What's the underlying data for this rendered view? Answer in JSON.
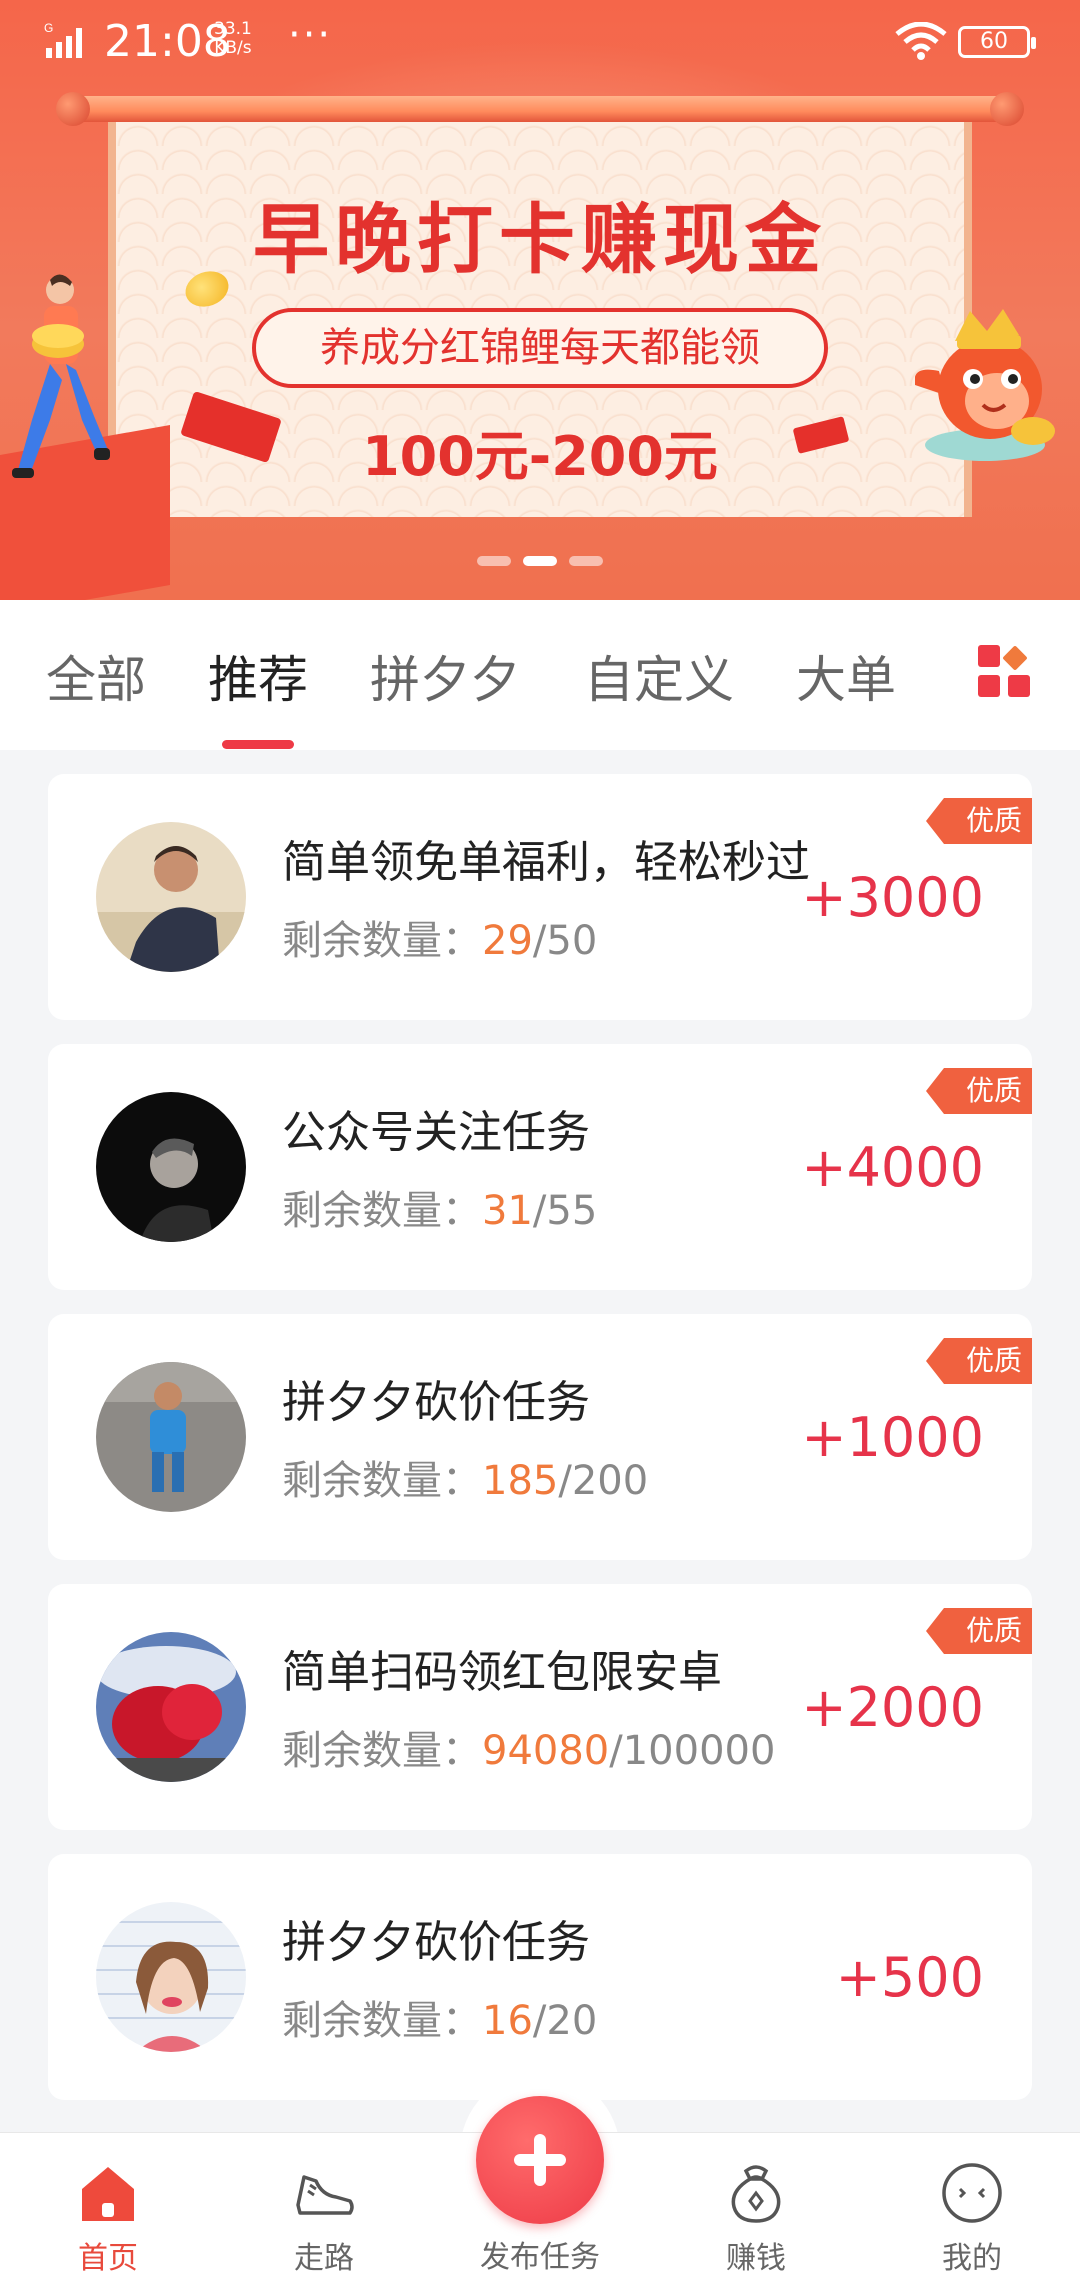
{
  "status_bar": {
    "time": "21:08",
    "net_speed_value": "33.1",
    "net_speed_unit": "KB/s",
    "more": "···",
    "battery": "60"
  },
  "banner": {
    "title": "早晚打卡赚现金",
    "subtitle": "养成分红锦鲤每天都能领",
    "amount": "100元-200元",
    "slide_count": 3,
    "active_slide": 1,
    "accent_color": "#e3322e"
  },
  "tabs": {
    "items": [
      {
        "label": "全部"
      },
      {
        "label": "推荐"
      },
      {
        "label": "拼夕夕"
      },
      {
        "label": "自定义"
      },
      {
        "label": "大单"
      }
    ],
    "active_index": 1,
    "more_icon": "grid-icon"
  },
  "tasks": [
    {
      "title": "简单领免单福利，轻松秒过",
      "remain_label": "剩余数量：",
      "remaining": "29",
      "total": "/50",
      "reward": "+3000",
      "badge": "优质",
      "avatar": "avatar-child-drawing"
    },
    {
      "title": "公众号关注任务",
      "remain_label": "剩余数量：",
      "remaining": "31",
      "total": "/55",
      "reward": "+4000",
      "badge": "优质",
      "avatar": "avatar-boy-dark"
    },
    {
      "title": "拼夕夕砍价任务",
      "remain_label": "剩余数量：",
      "remaining": "185",
      "total": "/200",
      "reward": "+1000",
      "badge": "优质",
      "avatar": "avatar-kid-running"
    },
    {
      "title": "简单扫码领红包限安卓",
      "remain_label": "剩余数量：",
      "remaining": "94080",
      "total": "/100000",
      "reward": "+2000",
      "badge": "优质",
      "avatar": "avatar-red-tree"
    },
    {
      "title": "拼夕夕砍价任务",
      "remain_label": "剩余数量：",
      "remaining": "16",
      "total": "/20",
      "reward": "+500",
      "badge": "",
      "avatar": "avatar-girl"
    }
  ],
  "bottom_nav": {
    "items": [
      {
        "label": "首页",
        "icon": "home-icon"
      },
      {
        "label": "走路",
        "icon": "shoe-icon"
      },
      {
        "label": "发布任务",
        "icon": "plus-icon"
      },
      {
        "label": "赚钱",
        "icon": "money-bag-icon"
      },
      {
        "label": "我的",
        "icon": "face-icon"
      }
    ],
    "active_index": 0,
    "active_color": "#e84a3c"
  }
}
